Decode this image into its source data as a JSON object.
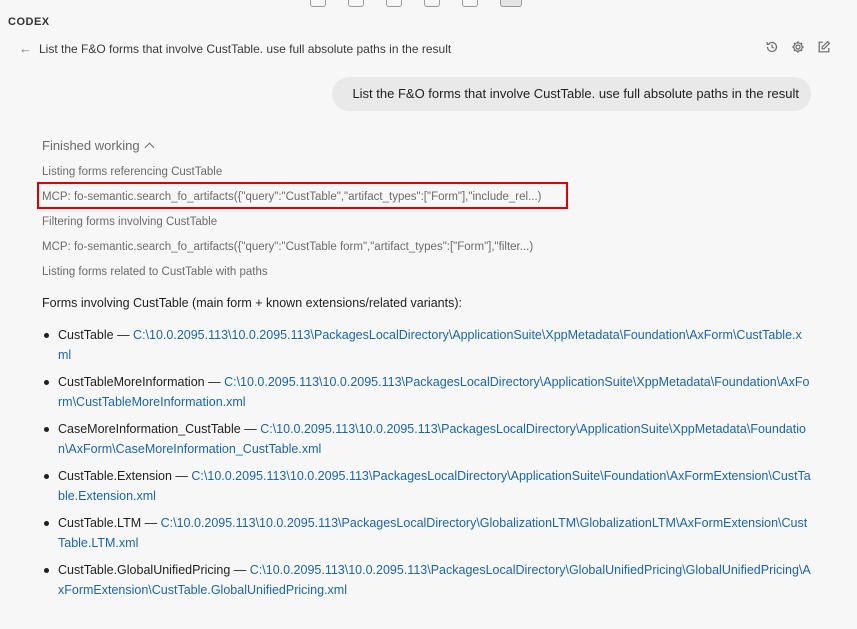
{
  "app": {
    "title": "CODEX"
  },
  "header": {
    "thread_title": "List the F&O forms that involve CustTable. use full absolute paths in the result",
    "icons": [
      "history-icon",
      "gear-icon",
      "edit-icon"
    ]
  },
  "conversation": {
    "user_message": "List the F&O forms that involve CustTable. use full absolute paths in the result",
    "status_label": "Finished working",
    "steps": [
      "Listing forms referencing CustTable",
      "MCP: fo-semantic.search_fo_artifacts({\"query\":\"CustTable\",\"artifact_types\":[\"Form\"],\"include_rel...)",
      "Filtering forms involving CustTable",
      "MCP: fo-semantic.search_fo_artifacts({\"query\":\"CustTable form\",\"artifact_types\":[\"Form\"],\"filter...)",
      "Listing forms related to CustTable with paths"
    ],
    "result_intro": "Forms involving CustTable (main form + known extensions/related variants):",
    "forms": [
      {
        "name": "CustTable",
        "separator": " — ",
        "path": "C:\\10.0.2095.113\\10.0.2095.113\\PackagesLocalDirectory\\ApplicationSuite\\XppMetadata\\Foundation\\AxForm\\CustTable.xml"
      },
      {
        "name": "CustTableMoreInformation",
        "separator": " — ",
        "path": "C:\\10.0.2095.113\\10.0.2095.113\\PackagesLocalDirectory\\ApplicationSuite\\XppMetadata\\Foundation\\AxForm\\CustTableMoreInformation.xml"
      },
      {
        "name": "CaseMoreInformation_CustTable",
        "separator": " — ",
        "path": "C:\\10.0.2095.113\\10.0.2095.113\\PackagesLocalDirectory\\ApplicationSuite\\XppMetadata\\Foundation\\AxForm\\CaseMoreInformation_CustTable.xml"
      },
      {
        "name": "CustTable.Extension",
        "separator": " — ",
        "path": "C:\\10.0.2095.113\\10.0.2095.113\\PackagesLocalDirectory\\ApplicationSuite\\Foundation\\AxFormExtension\\CustTable.Extension.xml"
      },
      {
        "name": "CustTable.LTM",
        "separator": " — ",
        "path": "C:\\10.0.2095.113\\10.0.2095.113\\PackagesLocalDirectory\\GlobalizationLTM\\GlobalizationLTM\\AxFormExtension\\CustTable.LTM.xml"
      },
      {
        "name": "CustTable.GlobalUnifiedPricing",
        "separator": " — ",
        "path": "C:\\10.0.2095.113\\10.0.2095.113\\PackagesLocalDirectory\\GlobalUnifiedPricing\\GlobalUnifiedPricing\\AxFormExtension\\CustTable.GlobalUnifiedPricing.xml"
      }
    ]
  },
  "colors": {
    "background": "#f7f7f7",
    "link": "#1a64b0",
    "highlight_border": "#e00000",
    "bubble": "#e9e9e9"
  }
}
